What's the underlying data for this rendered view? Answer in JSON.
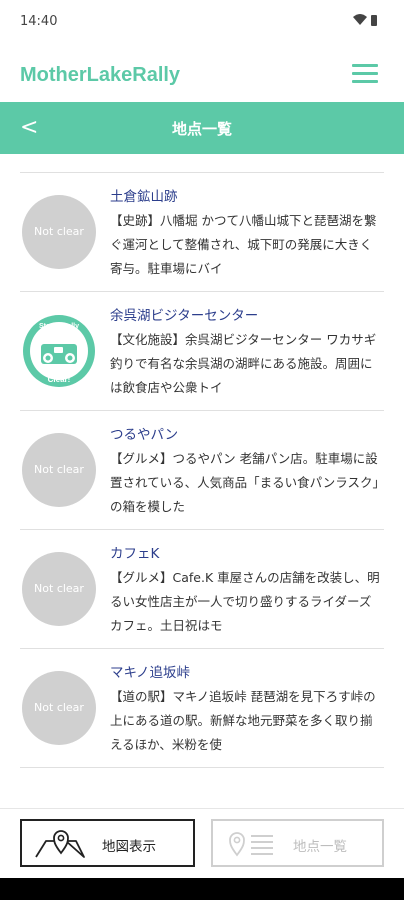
{
  "status_bar": {
    "time": "14:40",
    "icons": [
      "wifi-icon",
      "battery-icon"
    ]
  },
  "app_bar": {
    "title": "MotherLakeRally",
    "menu_icon": "hamburger-menu-icon"
  },
  "nav_bar": {
    "back_label": "<",
    "title": "地点一覧"
  },
  "colors": {
    "accent": "#5cc9a7",
    "title_link": "#2c3e8c",
    "not_clear_badge": "#d0d0d0"
  },
  "spots": [
    {
      "name": "土倉鉱山跡",
      "status": "Not clear",
      "cleared": false,
      "description": "【史跡】八幡堀 かつて八幡山城下と琵琶湖を繋ぐ運河として整備され、城下町の発展に大きく寄与。駐車場にバイ"
    },
    {
      "name": "余呉湖ビジターセンター",
      "status": "cleared",
      "cleared": true,
      "stamp_top": "Stamp Rally",
      "stamp_bottom": "Clear!",
      "description": "【文化施設】余呉湖ビジターセンター ワカサギ釣りで有名な余呉湖の湖畔にある施設。周囲には飲食店や公衆トイ"
    },
    {
      "name": "つるやパン",
      "status": "Not clear",
      "cleared": false,
      "description": "【グルメ】つるやパン 老舗パン店。駐車場に設置されている、人気商品「まるい食パンラスク」の箱を模した"
    },
    {
      "name": "カフェK",
      "status": "Not clear",
      "cleared": false,
      "description": "【グルメ】Cafe.K 車屋さんの店舗を改装し、明るい女性店主が一人で切り盛りするライダーズカフェ。土日祝はモ"
    },
    {
      "name": "マキノ追坂峠",
      "status": "Not clear",
      "cleared": false,
      "description": "【道の駅】マキノ追坂峠 琵琶湖を見下ろす峠の上にある道の駅。新鮮な地元野菜を多く取り揃えるほか、米粉を使"
    }
  ],
  "bottom_tabs": {
    "map": {
      "label": "地図表示",
      "icon": "map-pin-icon"
    },
    "list": {
      "label": "地点一覧",
      "icon": "pin-list-icon"
    }
  }
}
